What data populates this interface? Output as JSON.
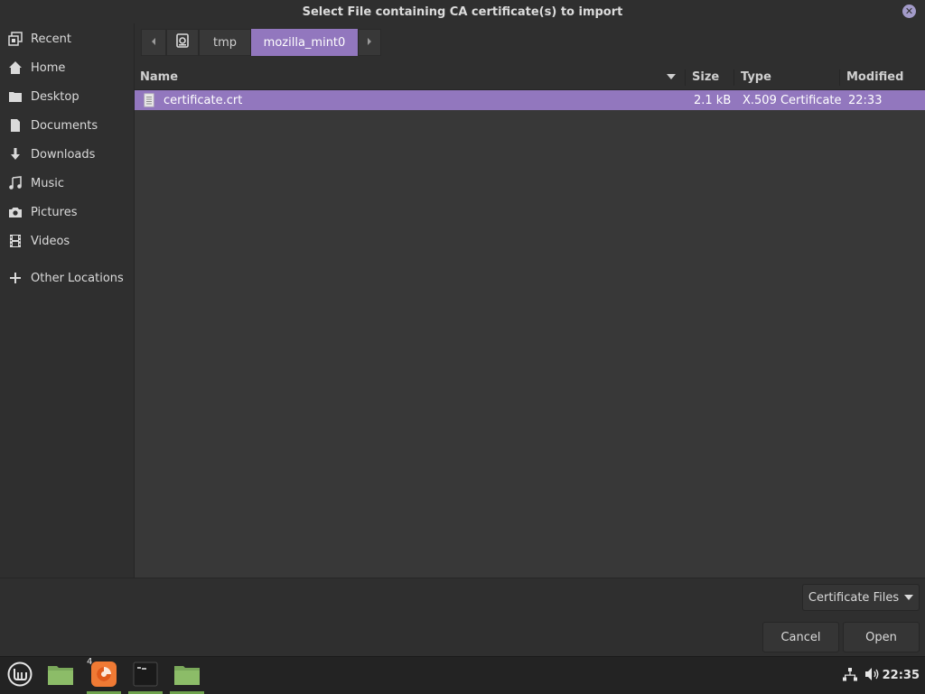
{
  "dialog": {
    "title": "Select File containing CA certificate(s) to import"
  },
  "sidebar": {
    "items": [
      {
        "label": "Recent",
        "icon": "recent-icon"
      },
      {
        "label": "Home",
        "icon": "home-icon"
      },
      {
        "label": "Desktop",
        "icon": "desktop-icon"
      },
      {
        "label": "Documents",
        "icon": "documents-icon"
      },
      {
        "label": "Downloads",
        "icon": "downloads-icon"
      },
      {
        "label": "Music",
        "icon": "music-icon"
      },
      {
        "label": "Pictures",
        "icon": "pictures-icon"
      },
      {
        "label": "Videos",
        "icon": "videos-icon"
      }
    ],
    "other_locations": "Other Locations"
  },
  "pathbar": {
    "segments": [
      "tmp",
      "mozilla_mint0"
    ],
    "active": "mozilla_mint0"
  },
  "file_list": {
    "columns": {
      "name": "Name",
      "size": "Size",
      "type": "Type",
      "modified": "Modified"
    },
    "rows": [
      {
        "name": "certificate.crt",
        "size": "2.1 kB",
        "type": "X.509 Certificate",
        "modified": "22:33",
        "selected": true
      }
    ]
  },
  "footer": {
    "filter": "Certificate Files",
    "cancel": "Cancel",
    "open": "Open"
  },
  "taskbar": {
    "firefox_badge": "4",
    "clock": "22:35"
  },
  "colors": {
    "accent": "#9277be",
    "background": "#2f2f2f",
    "list_background": "#383838",
    "taskbar_active": "#6fa34d"
  }
}
